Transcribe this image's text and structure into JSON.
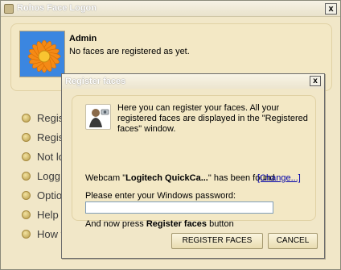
{
  "window": {
    "title": "Rohos Face Logon",
    "close_glyph": "x"
  },
  "profile": {
    "name": "Admin",
    "status": "No faces are registered as yet."
  },
  "menu": {
    "items": [
      {
        "label": "Regis"
      },
      {
        "label": "Regis"
      },
      {
        "label": "Not lo"
      },
      {
        "label": "Logg"
      },
      {
        "label": "Optio"
      },
      {
        "label": "Help"
      },
      {
        "label": "How t"
      }
    ]
  },
  "dialog": {
    "title": "Register faces",
    "close_glyph": "x",
    "intro": "Here you can register your faces. All your registered faces are displayed in the \"Registered faces\" window.",
    "webcam_prefix": "Webcam \"",
    "webcam_name": "Logitech QuickCa...",
    "webcam_suffix": "\" has been found",
    "change_link": "[Change...]",
    "password_label": "Please enter your Windows password:",
    "password_value": "",
    "hint_prefix": "And now press ",
    "hint_bold": "Register faces",
    "hint_suffix": " button",
    "register_button": "REGISTER FACES",
    "cancel_button": "CANCEL"
  },
  "colors": {
    "panel": "#f3e8c5",
    "window_bg": "#f1e7c8",
    "link": "#0000aa"
  },
  "icons": [
    "flower-avatar-icon",
    "register-face-icon",
    "bullet-icon"
  ]
}
